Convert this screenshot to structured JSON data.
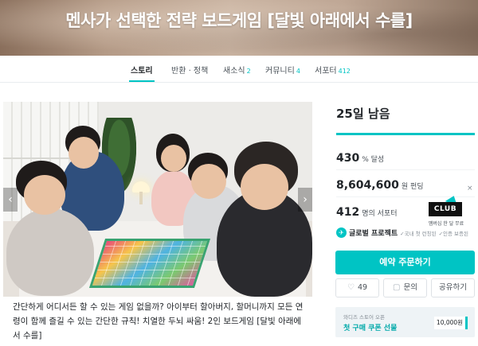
{
  "hero": {
    "title": "멘사가 선택한 전략 보드게임 [달빛 아래에서 수를]"
  },
  "tabs": [
    {
      "label": "스토리",
      "count": "",
      "active": true
    },
    {
      "label": "반환 · 정책",
      "count": ""
    },
    {
      "label": "새소식",
      "count": "2"
    },
    {
      "label": "커뮤니티",
      "count": "4"
    },
    {
      "label": "서포터",
      "count": "412"
    }
  ],
  "image": {
    "prev_icon": "chevron-left-icon",
    "next_icon": "chevron-right-icon",
    "prev_glyph": "‹",
    "next_glyph": "›"
  },
  "description": "간단하게 어디서든 할 수 있는 게임 없을까? 아이부터 할아버지, 할머니까지 모든 연령이 함께 즐길 수 있는 간단한 규칙! 치열한 두뇌 싸움! 2인 보드게임 [달빛 아래에서 수를]",
  "funding": {
    "days_left": "25일 남음",
    "percent": "430",
    "percent_unit": "% 달성",
    "amount": "8,604,600",
    "amount_unit": "원 펀딩",
    "supporters": "412",
    "supporters_unit": "명의 서포터"
  },
  "club": {
    "badge": "CLUB",
    "sub": "멤버십 한 달 무료",
    "close": "×"
  },
  "global": {
    "icon": "airplane-icon",
    "glyph": "✈",
    "label": "글로벌 프로젝트",
    "note1": "✓국내 첫 런칭된",
    "note2": "✓인증 보증된"
  },
  "actions": {
    "primary": "예약 주문하기",
    "like_count": "49",
    "like_glyph": "♡",
    "inquiry": "문의",
    "inquiry_glyph": "▢",
    "share": "공유하기"
  },
  "coupon": {
    "line1": "와디즈 스토어 오픈",
    "line2": "첫 구매 쿠폰 선물",
    "amount": "10,000원"
  },
  "colors": {
    "accent": "#00c4c4",
    "text": "#212529",
    "muted": "#495057"
  }
}
